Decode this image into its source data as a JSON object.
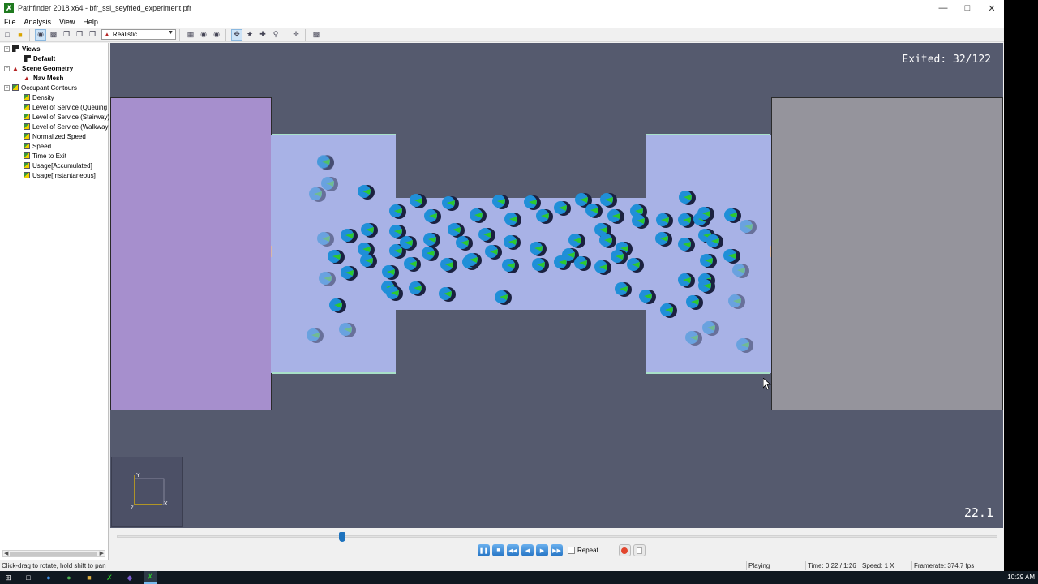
{
  "window": {
    "title": "Pathfinder 2018 x64 - bfr_ssl_seyfried_experiment.pfr",
    "app_icon": "pathfinder-logo-icon",
    "controls": [
      "minimize-icon",
      "maximize-icon",
      "close-icon"
    ]
  },
  "menu": [
    "File",
    "Analysis",
    "View",
    "Help"
  ],
  "toolbar": {
    "render_mode": "Realistic"
  },
  "tree": {
    "views_label": "Views",
    "default_label": "Default",
    "scene_label": "Scene Geometry",
    "navmesh_label": "Nav Mesh",
    "contours_label": "Occupant Contours",
    "contours": [
      "Density",
      "Level of Service (Queuing",
      "Level of Service (Stairway)",
      "Level of Service (Walkway",
      "Normalized Speed",
      "Speed",
      "Time to Exit",
      "Usage[Accumulated]",
      "Usage[Instantaneous]"
    ]
  },
  "viewport": {
    "exited_label": "Exited:",
    "exited_value": "32/122",
    "framerate_overlay": "22.1",
    "axis_labels": {
      "y": "Y",
      "x": "X",
      "z": "Z"
    }
  },
  "playback": {
    "progress_fraction": 0.256,
    "repeat_label": "Repeat",
    "repeat_checked": false
  },
  "status": {
    "hint": "Click-drag to rotate, hold shift to pan",
    "state": "Playing",
    "time": "Time: 0:22 / 1:26",
    "speed": "Speed: 1 X",
    "framerate": "Framerate: 374.7 fps"
  },
  "taskbar": {
    "clock": "10:29 AM"
  },
  "colors": {
    "viewport_bg": "#555a6e",
    "room_left": "#a68fcd",
    "room_right": "#95949c",
    "corridor": "#a8b2e6",
    "agent_body": "#1f8fd8",
    "agent_mark": "#2ec82e",
    "accent": "#1e73be"
  }
}
